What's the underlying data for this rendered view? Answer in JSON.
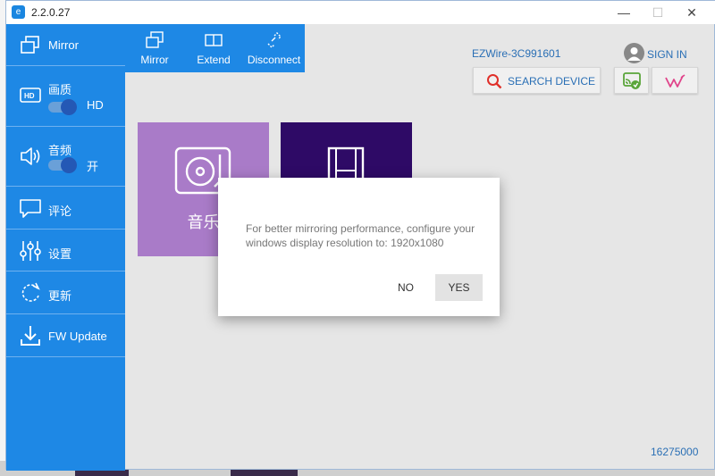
{
  "window": {
    "version": "2.2.0.27",
    "app_icon_glyph": "e",
    "controls": {
      "minimize": "—",
      "maximize": "☐",
      "close": "✕"
    }
  },
  "sidebar": {
    "items": [
      {
        "label": "Mirror",
        "icon": "mirror-icon"
      },
      {
        "label": "画质",
        "icon": "hd-icon",
        "toggle_value": "HD",
        "toggle_on": true
      },
      {
        "label": "音频",
        "icon": "speaker-icon",
        "toggle_value": "开",
        "toggle_on": true
      },
      {
        "label": "评论",
        "icon": "comment-icon"
      },
      {
        "label": "设置",
        "icon": "sliders-icon"
      },
      {
        "label": "更新",
        "icon": "refresh-icon"
      },
      {
        "label": "FW Update",
        "icon": "download-icon"
      }
    ]
  },
  "modebar": {
    "buttons": [
      {
        "label": "Mirror",
        "icon": "mirror-icon"
      },
      {
        "label": "Extend",
        "icon": "extend-icon"
      },
      {
        "label": "Disconnect",
        "icon": "disconnect-icon"
      }
    ]
  },
  "header": {
    "device_name": "EZWire-3C991601",
    "sign_in_label": "SIGN IN",
    "search_device_label": "SEARCH DEVICE"
  },
  "tiles": {
    "music_label": "音乐",
    "video_label": ""
  },
  "dialog": {
    "message": "For better mirroring performance, configure your windows display resolution to: 1920x1080",
    "no_label": "NO",
    "yes_label": "YES"
  },
  "footer": {
    "serial": "16275000"
  },
  "colors": {
    "sidebar_blue": "#1e88e5",
    "link_blue": "#2a6fb5",
    "music_tile": "#a97bc8",
    "video_tile": "#2e0a66",
    "toggle_knob": "#2458b5"
  }
}
